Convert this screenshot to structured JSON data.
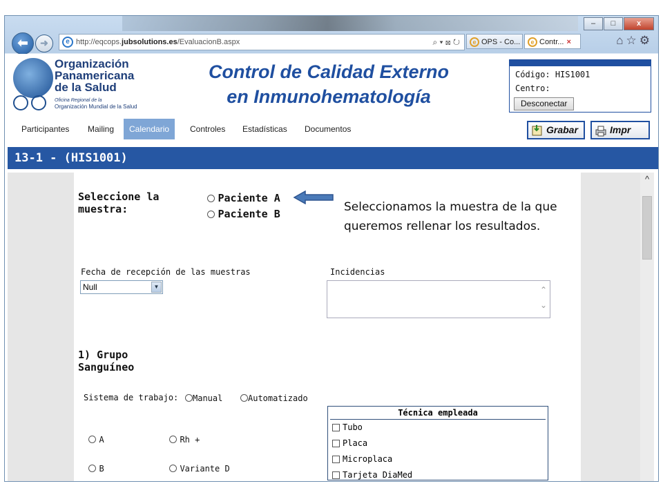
{
  "browser": {
    "url_prefix": "http://eqcops.",
    "url_domain": "jubsolutions.es",
    "url_path": "/EvaluacionB.aspx",
    "addr_controls": "⌕ ▾ ⊠ ↻",
    "tabs": [
      {
        "label": "OPS - Co..."
      },
      {
        "label": "Contr..."
      }
    ],
    "tab_close": "×",
    "toolbar_icons": [
      "home-icon",
      "star-icon",
      "gear-icon"
    ],
    "window_buttons": [
      "–",
      "□",
      "x"
    ]
  },
  "header": {
    "org_name_1": "Organización",
    "org_name_2": "Panamericana",
    "org_name_3": "de la Salud",
    "org_small_1": "Oficina Regional de la",
    "org_small_2": "Organización Mundial de la Salud",
    "title_line1": "Control de Calidad Externo",
    "title_line2": "en Inmunohematología"
  },
  "login": {
    "codigo_label": "Código:",
    "codigo_value": "HIS1001",
    "centro_label": "Centro:",
    "centro_value": "",
    "logout_label": "Desconectar"
  },
  "menu": {
    "items": [
      "Participantes",
      "Mailing",
      "Calendario",
      "Controles",
      "Estadísticas",
      "Documentos"
    ],
    "active": "Calendario",
    "save_label": "Grabar",
    "print_label": "Impr"
  },
  "section_title": "13-1 - (HIS1001)",
  "form": {
    "select_sample_label_1": "Seleccione la",
    "select_sample_label_2": "muestra:",
    "sample_options": [
      "Paciente A",
      "Paciente B"
    ],
    "annotation_line1": "Seleccionamos la muestra de la que",
    "annotation_line2": "queremos rellenar los resultados.",
    "fecha_label": "Fecha de recepción de las muestras",
    "fecha_value": "Null",
    "incidencias_label": "Incidencias",
    "incidencias_value": "",
    "group_title_1": "1) Grupo",
    "group_title_2": "Sanguíneo",
    "sistema_label": "Sistema de trabajo:",
    "sistema_options": [
      "Manual",
      "Automatizado"
    ],
    "blood_options_col1": [
      "A",
      "B"
    ],
    "blood_options_col2": [
      "Rh +",
      "Variante D"
    ],
    "tecnica_header": "Técnica empleada",
    "tecnica_options": [
      "Tubo",
      "Placa",
      "Microplaca",
      "Tarjeta DiaMed"
    ]
  },
  "colors": {
    "brand_blue": "#1f4fa0",
    "section_bar": "#2657a3",
    "menu_active": "#7fa6d6"
  }
}
